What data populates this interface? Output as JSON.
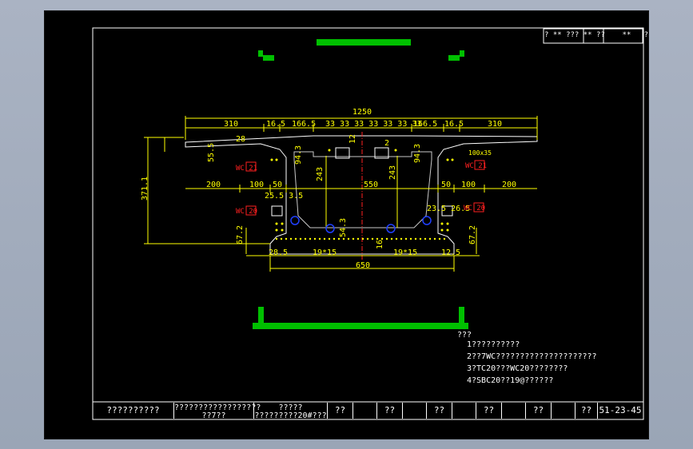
{
  "title_block_top": {
    "text": "? ** ??? ** ??    **   ?"
  },
  "dimensions": {
    "overall_width": "1250",
    "top_segments": [
      "310",
      "16.5",
      "166.5",
      "33",
      "33",
      "33",
      "33",
      "33",
      "33",
      "33",
      "166.5",
      "16.5",
      "310"
    ],
    "mid_segments": [
      "200",
      "100",
      "50",
      "550",
      "50",
      "100",
      "200"
    ],
    "bottom_segments": [
      "28.5",
      "19*15",
      "16",
      "19*15",
      "12.5"
    ],
    "bottom_width": "650",
    "height_total": "371.1",
    "web_height_left": "243",
    "web_height_right": "243",
    "slope_left": "94.3",
    "slope_right": "94.3",
    "inner_left": "25.5",
    "inner_left_b": "3.5",
    "inner_right": "23.5",
    "inner_right_b": "26.5",
    "bottom_thick_left": "67.2",
    "bottom_thick_right": "67.2",
    "thick_left_b": "12",
    "thick_right_b": "12",
    "top_left_small": "55.5",
    "top_left_small2": "12",
    "corner_tag": "100x35",
    "center_tag_left": "12",
    "center_tag_right": "2",
    "dim_28": "28",
    "dim_54_3": "54.3"
  },
  "labels": {
    "wc_left_upper": "WC",
    "wc_left_upper_num": "21",
    "wc_right_upper": "WC",
    "wc_right_upper_num": "21",
    "wc_left_lower": "WC",
    "wc_left_lower_num": "20",
    "wc_right_lower": "WC",
    "wc_right_lower_num": "20"
  },
  "notes": {
    "heading": "???",
    "items": [
      "1??????????",
      "2??7WC?????????????????????",
      "3?TC20???WC20????????",
      "4?SBC20??19@??????"
    ]
  },
  "title_block": {
    "cells": [
      "??????????",
      "??????????????????\n??7??",
      "?????\n?????????20#???",
      "??",
      "??",
      "??",
      "??",
      "??",
      "??"
    ],
    "drawing_no": "51-23-45"
  },
  "colors": {
    "background": "#000000",
    "dim": "#ffff00",
    "section": "#ffffff",
    "tag_green": "#00c000",
    "tag_red": "#ff2020",
    "tag_blue": "#2040ff",
    "center": "#ff2020"
  }
}
